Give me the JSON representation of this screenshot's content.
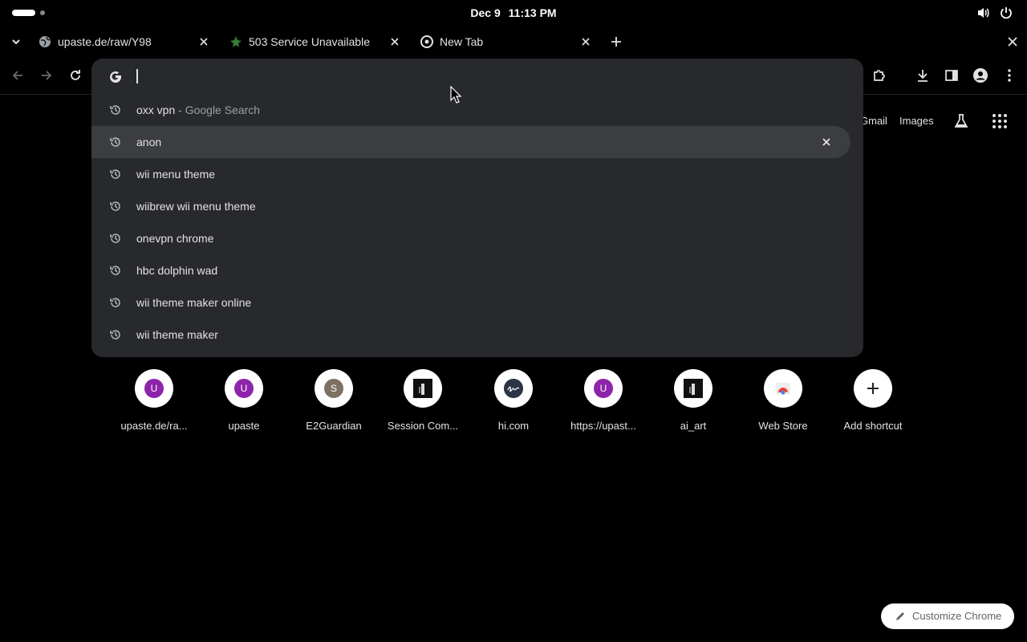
{
  "system": {
    "date": "Dec 9",
    "time": "11:13 PM"
  },
  "tabs": [
    {
      "title": "upaste.de/raw/Y98",
      "favicon": "globe-icon"
    },
    {
      "title": "503 Service Unavailable",
      "favicon": "e2guardian-icon"
    },
    {
      "title": "New Tab",
      "favicon": "chrome-icon"
    }
  ],
  "ntp": {
    "gmail": "Gmail",
    "images": "Images"
  },
  "omnibox": {
    "value": "",
    "suggestions": [
      {
        "text": "oxx vpn",
        "desc": " - Google Search"
      },
      {
        "text": "anon",
        "desc": ""
      },
      {
        "text": "wii menu theme",
        "desc": ""
      },
      {
        "text": "wiibrew wii menu theme",
        "desc": ""
      },
      {
        "text": "onevpn chrome",
        "desc": ""
      },
      {
        "text": "hbc dolphin wad",
        "desc": ""
      },
      {
        "text": "wii theme maker online",
        "desc": ""
      },
      {
        "text": "wii theme maker",
        "desc": ""
      }
    ]
  },
  "shortcuts": [
    {
      "label": "upaste.de/ra...",
      "letter": "U",
      "color": "#8e24aa"
    },
    {
      "label": "upaste",
      "letter": "U",
      "color": "#8e24aa"
    },
    {
      "label": "E2Guardian",
      "letter": "S",
      "color": "#7d7262"
    },
    {
      "label": "Session Com...",
      "letter": "",
      "color": "#111111"
    },
    {
      "label": "hi.com",
      "letter": "",
      "color": "#2c3545"
    },
    {
      "label": "https://upast...",
      "letter": "U",
      "color": "#8e24aa"
    },
    {
      "label": "ai_art",
      "letter": "",
      "color": "#111111"
    },
    {
      "label": "Web Store",
      "letter": "",
      "color": "#ffffff"
    },
    {
      "label": "Add shortcut",
      "letter": "",
      "color": "#ffffff"
    }
  ],
  "customize": {
    "label": "Customize Chrome"
  }
}
